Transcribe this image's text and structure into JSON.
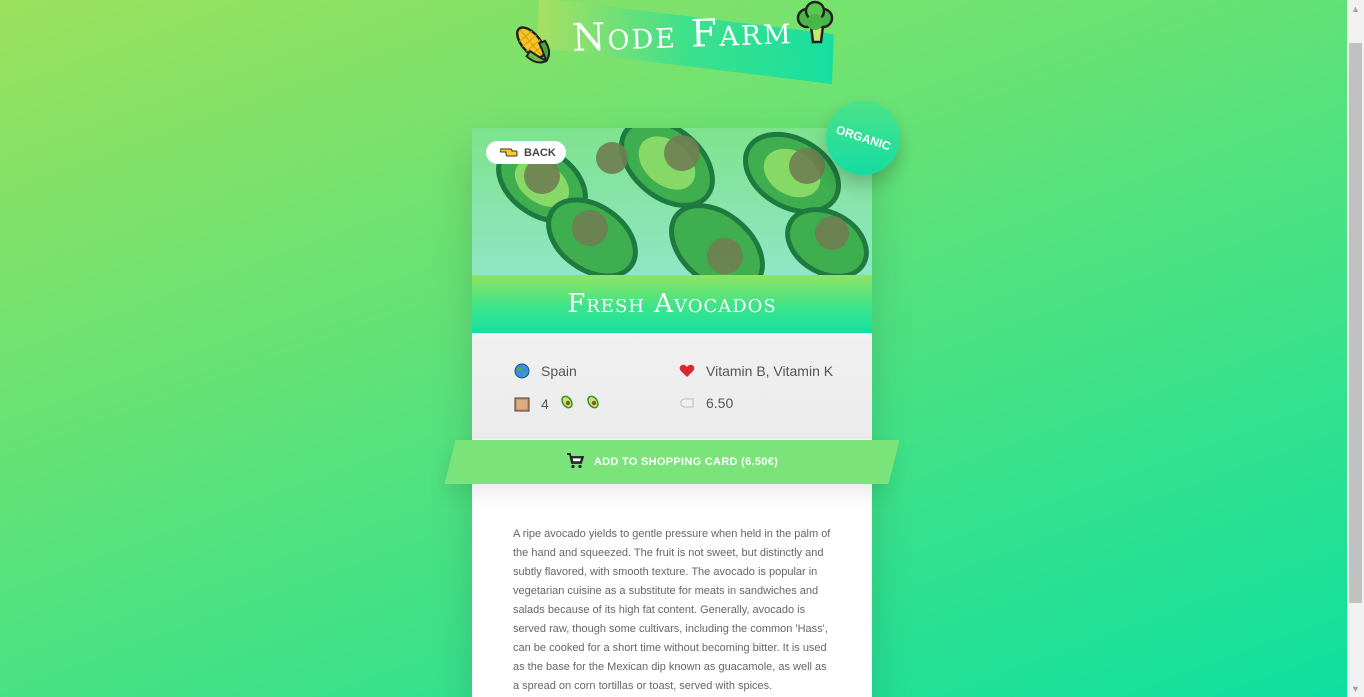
{
  "header": {
    "logo_text": "Node Farm",
    "logo_left_icon": "corn-icon",
    "logo_right_icon": "broccoli-icon"
  },
  "product": {
    "back_label": "BACK",
    "badge": "ORGANIC",
    "name": "Fresh Avocados",
    "origin": "Spain",
    "nutrients": "Vitamin B, Vitamin K",
    "quantity": "4",
    "price": "6.50",
    "cart_label": "ADD TO SHOPPING CARD (6.50€)",
    "description": "A ripe avocado yields to gentle pressure when held in the palm of the hand and squeezed. The fruit is not sweet, but distinctly and subtly flavored, with smooth texture. The avocado is popular in vegetarian cuisine as a substitute for meats in sandwiches and salads because of its high fat content. Generally, avocado is served raw, though some cultivars, including the common 'Hass', can be cooked for a short time without becoming bitter. It is used as the base for the Mexican dip known as guacamole, as well as a spread on corn tortillas or toast, served with spices."
  },
  "colors": {
    "accent": "#7ae47a",
    "title_band_bottom": "#14e0a3",
    "badge": "#2fe095"
  }
}
